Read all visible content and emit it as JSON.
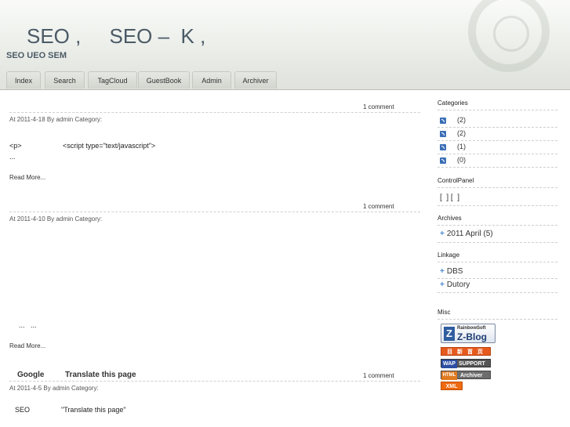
{
  "header": {
    "title": "SEO ,     SEO –  K ,",
    "subtitle": "SEO UEO SEM"
  },
  "nav": {
    "tabs": [
      "Index",
      "Search",
      "TagCloud",
      "GuestBook",
      "Admin",
      "Archiver"
    ]
  },
  "posts": [
    {
      "comments": "1 comment",
      "meta": "At 2011-4-18 By admin Category:",
      "line1_a": "<p>",
      "line1_b": "<script type=\"text/javascript\">",
      "line2": "...",
      "read_more": "Read More..."
    },
    {
      "comments": "1 comment",
      "meta": "At 2011-4-10 By admin Category:",
      "line1": "...   ...",
      "read_more": "Read More..."
    },
    {
      "title_a": "Google",
      "title_b": "Translate this page",
      "comments": "1 comment",
      "meta": "At 2011-4-5 By admin Category:",
      "line1_a": "SEO",
      "line1_b": "\"Translate this page\""
    }
  ],
  "sidebar": {
    "categories": {
      "heading": "Categories",
      "items": [
        "(2)",
        "(2)",
        "(1)",
        "(0)"
      ]
    },
    "control_panel": {
      "heading": "ControlPanel",
      "text": "[  ] [  ]"
    },
    "archives": {
      "heading": "Archives",
      "items": [
        "2011 April (5)"
      ]
    },
    "linkage": {
      "heading": "Linkage",
      "items": [
        "DBS",
        "Dutory"
      ]
    },
    "misc": {
      "heading": "Misc",
      "zblog_top": "RainbowSoft",
      "zblog_main": "Z-Blog",
      "badge2": "目 新 首 页",
      "badge3_a": "WAP",
      "badge3_b": "SUPPORT",
      "badge4_a": "HTML",
      "badge4_b": "Archiver",
      "badge5": "XML"
    }
  }
}
